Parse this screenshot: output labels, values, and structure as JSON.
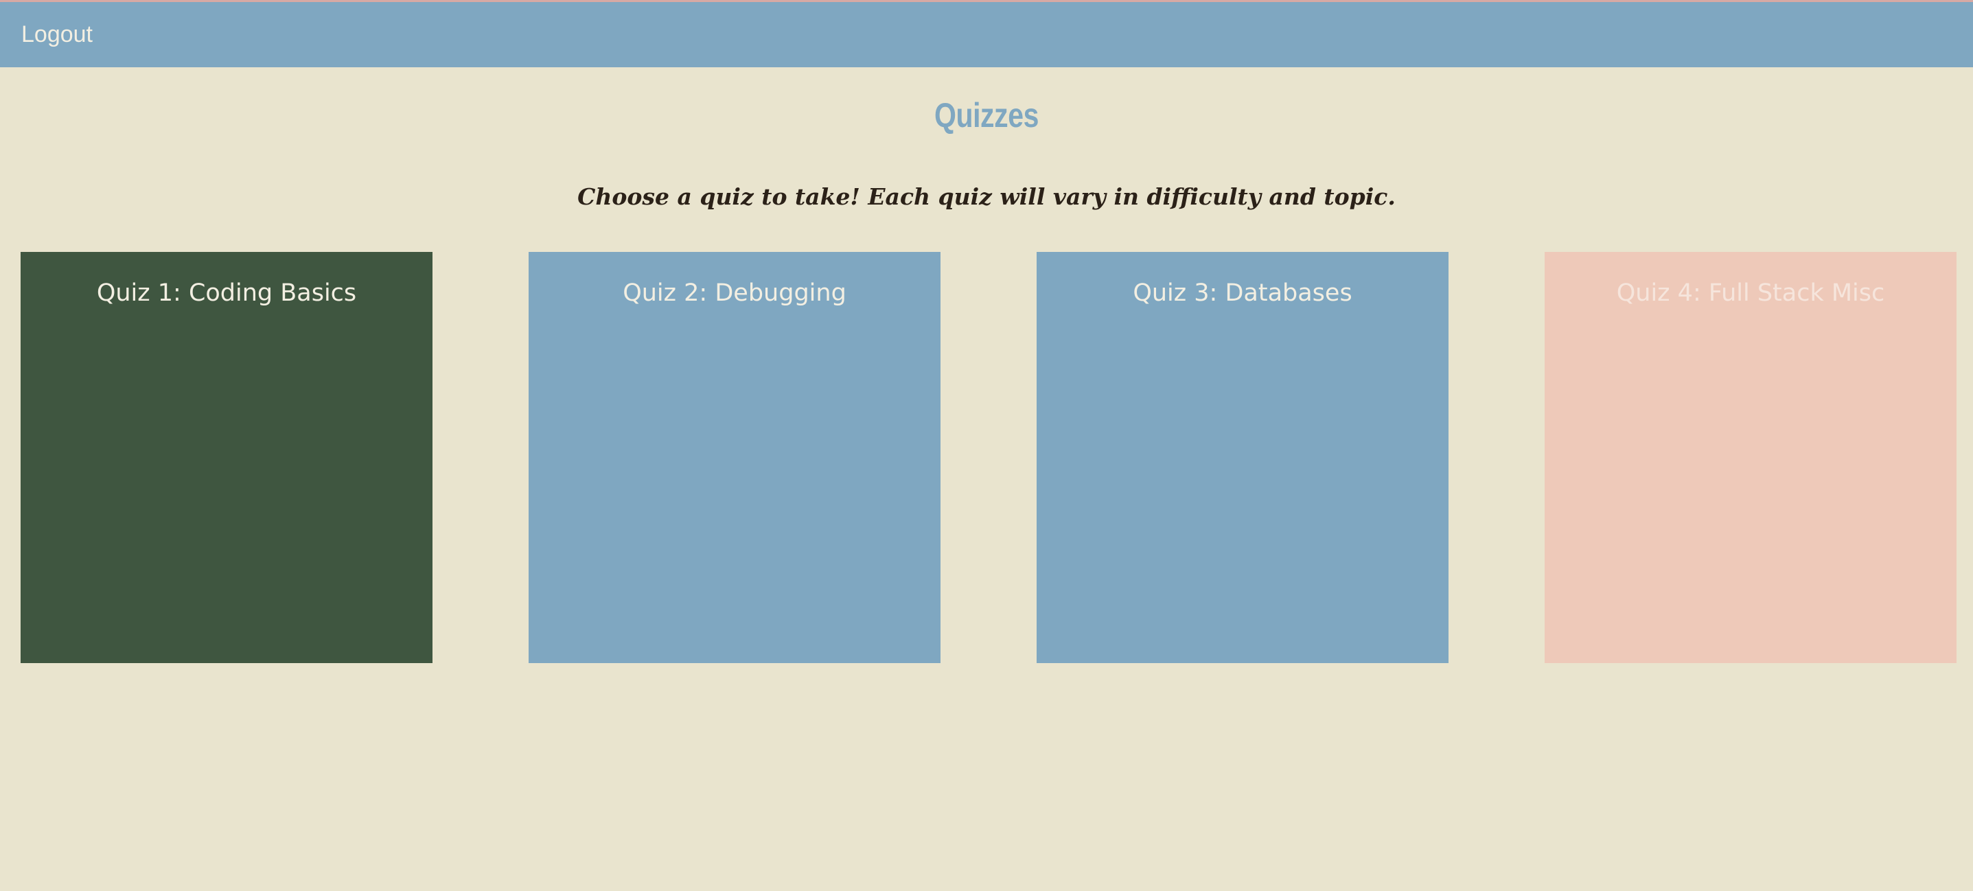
{
  "nav": {
    "logout_label": "Logout"
  },
  "page": {
    "title": "Quizzes",
    "subtitle": "Choose a quiz to take! Each quiz will vary in difficulty and topic."
  },
  "quizzes": [
    {
      "label": "Quiz 1: Coding Basics",
      "color": "#3f5640"
    },
    {
      "label": "Quiz 2: Debugging",
      "color": "#7fa7c1"
    },
    {
      "label": "Quiz 3: Databases",
      "color": "#7fa7c1"
    },
    {
      "label": "Quiz 4: Full Stack Misc",
      "color": "#eec9b9"
    }
  ],
  "colors": {
    "background": "#e9e4ce",
    "navbar": "#7fa7c1",
    "title": "#7fa7c1",
    "subtitle": "#2b2118"
  }
}
